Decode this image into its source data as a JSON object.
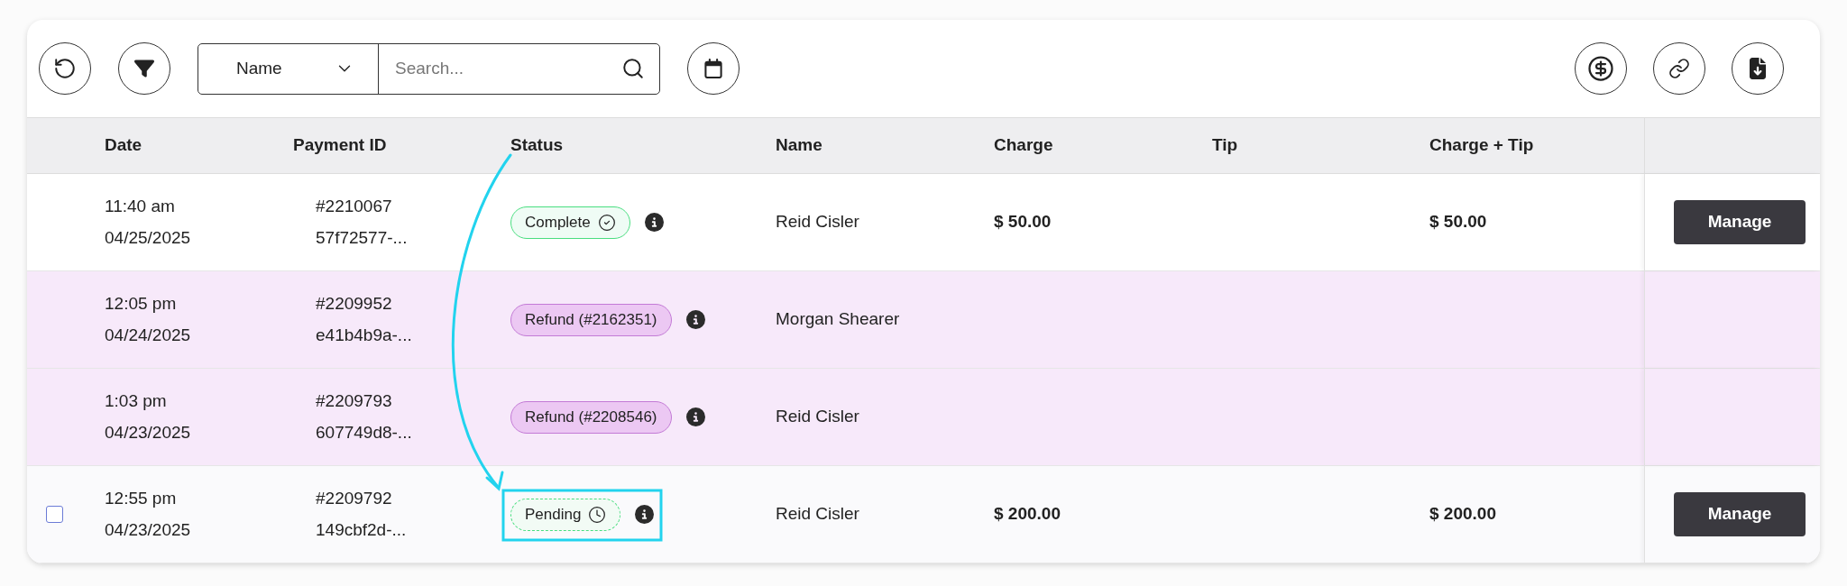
{
  "toolbar": {
    "search_by": "Name",
    "search": {
      "placeholder": "Search..."
    }
  },
  "table": {
    "columns": [
      "Date",
      "Payment ID",
      "Status",
      "Name",
      "Charge",
      "Tip",
      "Charge + Tip"
    ],
    "rows": [
      {
        "time": "11:40 am",
        "date": "04/25/2025",
        "payment_id": "#2210067",
        "payment_ref": "57f72577-...",
        "status": {
          "kind": "complete",
          "label": "Complete"
        },
        "name": "Reid Cisler",
        "charge": "$ 50.00",
        "tip": "",
        "total": "$ 50.00",
        "action": "Manage"
      },
      {
        "time": "12:05 pm",
        "date": "04/24/2025",
        "payment_id": "#2209952",
        "payment_ref": "e41b4b9a-...",
        "status": {
          "kind": "refund",
          "label": "Refund (#2162351)"
        },
        "name": "Morgan Shearer"
      },
      {
        "time": "1:03 pm",
        "date": "04/23/2025",
        "payment_id": "#2209793",
        "payment_ref": "607749d8-...",
        "status": {
          "kind": "refund",
          "label": "Refund (#2208546)"
        },
        "name": "Reid Cisler"
      },
      {
        "time": "12:55 pm",
        "date": "04/23/2025",
        "payment_id": "#2209792",
        "payment_ref": "149cbf2d-...",
        "status": {
          "kind": "pending",
          "label": "Pending"
        },
        "name": "Reid Cisler",
        "charge": "$ 200.00",
        "total": "$ 200.00",
        "action": "Manage",
        "checkbox": {
          "checked": false
        }
      }
    ]
  }
}
